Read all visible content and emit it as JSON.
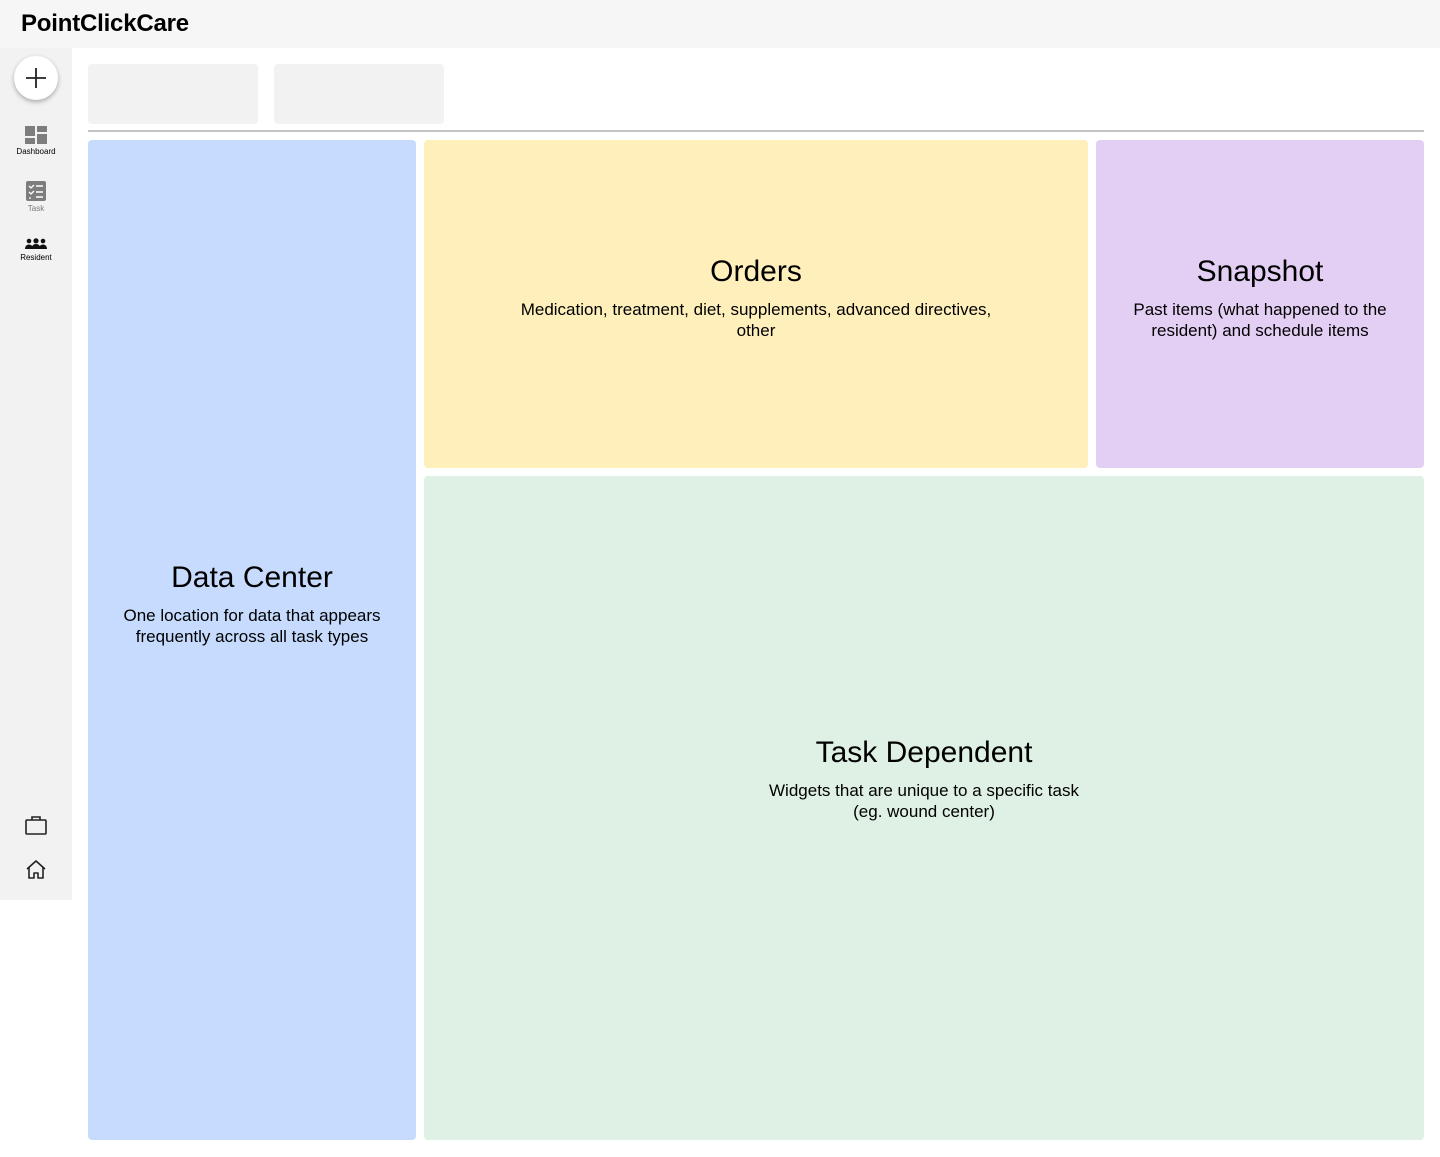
{
  "app": {
    "brand": "PointClickCare"
  },
  "sidebar": {
    "fab_icon": "plus-icon",
    "items": [
      {
        "label": "Dashboard",
        "icon": "dashboard-icon"
      },
      {
        "label": "Task",
        "icon": "checklist-icon"
      },
      {
        "label": "Resident",
        "icon": "people-icon"
      }
    ],
    "bottom_icons": [
      "briefcase-icon",
      "home-icon"
    ]
  },
  "tabs": [
    "",
    ""
  ],
  "panels": {
    "data_center": {
      "title": "Data Center",
      "description": "One location for data that appears frequently across all task types",
      "color": "#c6dbfd"
    },
    "orders": {
      "title": "Orders",
      "description": "Medication, treatment, diet, supplements, advanced directives, other",
      "color": "#feefbb"
    },
    "snapshot": {
      "title": "Snapshot",
      "description": "Past items (what happened to the resident) and schedule items",
      "color": "#e4cff4"
    },
    "task_dependent": {
      "title": "Task Dependent",
      "description": "Widgets that are unique to a specific task (eg. wound center)",
      "color": "#dff1e4"
    }
  }
}
